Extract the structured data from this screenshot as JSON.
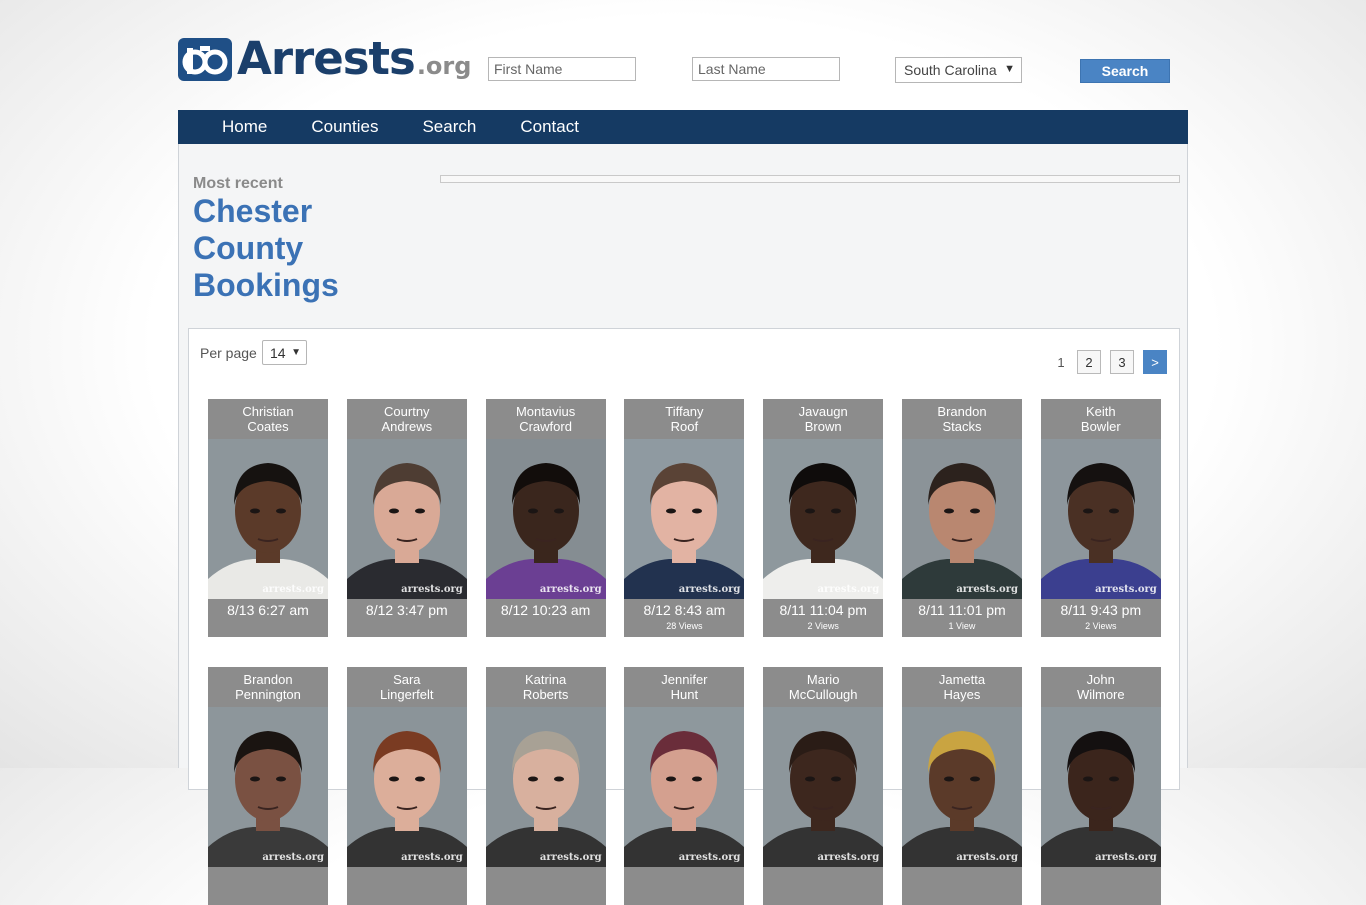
{
  "brand": {
    "name": "Arrests",
    "tld": ".org"
  },
  "search": {
    "first_name_placeholder": "First Name",
    "last_name_placeholder": "Last Name",
    "state_selected": "South Carolina",
    "button_label": "Search"
  },
  "nav": {
    "items": [
      "Home",
      "Counties",
      "Search",
      "Contact"
    ]
  },
  "page": {
    "subtitle": "Most recent",
    "title_lines": [
      "Chester",
      "County",
      "Bookings"
    ]
  },
  "results": {
    "per_page_label": "Per page",
    "per_page_value": "14",
    "pagination": {
      "current": "1",
      "pages": [
        "2",
        "3"
      ],
      "next": ">"
    },
    "watermark": "arrests.org",
    "bookings": [
      {
        "first": "Christian",
        "last": "Coates",
        "time": "8/13 6:27 am",
        "views": "",
        "skin": "#5b3a29",
        "hair": "#161210",
        "shirt": "#e9e9e6",
        "bg": "#8d969b"
      },
      {
        "first": "Courtny",
        "last": "Andrews",
        "time": "8/12 3:47 pm",
        "views": "",
        "skin": "#d9a996",
        "hair": "#4e3d33",
        "shirt": "#2a2b30",
        "bg": "#8a9398"
      },
      {
        "first": "Montavius",
        "last": "Crawford",
        "time": "8/12 10:23 am",
        "views": "",
        "skin": "#3a261d",
        "hair": "#120d0b",
        "shirt": "#6b3f93",
        "bg": "#858d92"
      },
      {
        "first": "Tiffany",
        "last": "Roof",
        "time": "8/12 8:43 am",
        "views": "28 Views",
        "skin": "#e2b3a3",
        "hair": "#5a4336",
        "shirt": "#22324f",
        "bg": "#8f9aa1"
      },
      {
        "first": "Javaugn",
        "last": "Brown",
        "time": "8/11 11:04 pm",
        "views": "2 Views",
        "skin": "#3e281e",
        "hair": "#0f0c0b",
        "shirt": "#eeeeec",
        "bg": "#8e989d"
      },
      {
        "first": "Brandon",
        "last": "Stacks",
        "time": "8/11 11:01 pm",
        "views": "1 View",
        "skin": "#b98770",
        "hair": "#2c221d",
        "shirt": "#2e3a3a",
        "bg": "#8b9398"
      },
      {
        "first": "Keith",
        "last": "Bowler",
        "time": "8/11 9:43 pm",
        "views": "2 Views",
        "skin": "#4a3024",
        "hair": "#151110",
        "shirt": "#3b3f8f",
        "bg": "#8d969c"
      },
      {
        "first": "Brandon",
        "last": "Pennington",
        "time": "",
        "views": "",
        "skin": "#7a5142",
        "hair": "#1a1411",
        "shirt": "#3a3a3a",
        "bg": "#8d969b"
      },
      {
        "first": "Sara",
        "last": "Lingerfelt",
        "time": "",
        "views": "",
        "skin": "#dcae9a",
        "hair": "#7a3b22",
        "shirt": "#333",
        "bg": "#8b9499"
      },
      {
        "first": "Katrina",
        "last": "Roberts",
        "time": "",
        "views": "",
        "skin": "#d8b09e",
        "hair": "#a8a195",
        "shirt": "#333",
        "bg": "#8a9398"
      },
      {
        "first": "Jennifer",
        "last": "Hunt",
        "time": "",
        "views": "",
        "skin": "#d4a08f",
        "hair": "#6a2d3a",
        "shirt": "#333",
        "bg": "#8e989d"
      },
      {
        "first": "Mario",
        "last": "McCullough",
        "time": "",
        "views": "",
        "skin": "#3d271e",
        "hair": "#2a1c16",
        "shirt": "#333",
        "bg": "#8d969b"
      },
      {
        "first": "Jametta",
        "last": "Hayes",
        "time": "",
        "views": "",
        "skin": "#5b3a29",
        "hair": "#c9a441",
        "shirt": "#333",
        "bg": "#8b9499"
      },
      {
        "first": "John",
        "last": "Wilmore",
        "time": "",
        "views": "",
        "skin": "#3b251c",
        "hair": "#141010",
        "shirt": "#333",
        "bg": "#8d969b"
      }
    ]
  }
}
